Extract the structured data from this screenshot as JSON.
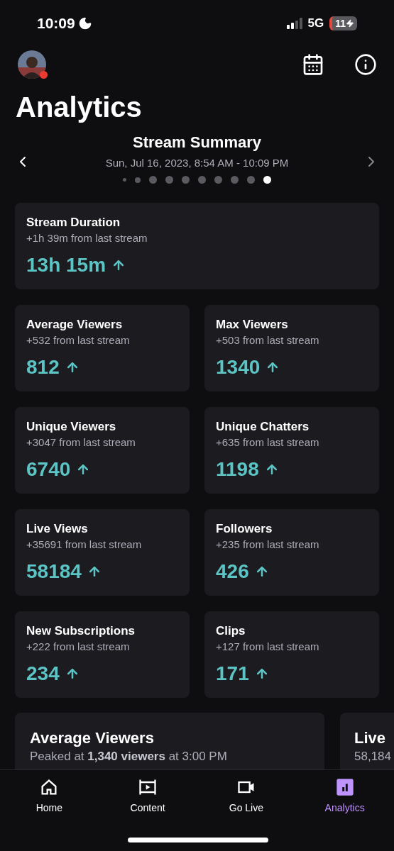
{
  "status_bar": {
    "time": "10:09",
    "network": "5G",
    "battery": "11"
  },
  "title": "Analytics",
  "summary": {
    "title": "Stream Summary",
    "date": "Sun, Jul 16, 2023, 8:54 AM - 10:09 PM",
    "pages": [
      {
        "selected": false
      },
      {
        "selected": false
      },
      {
        "selected": false
      },
      {
        "selected": false
      },
      {
        "selected": false
      },
      {
        "selected": false
      },
      {
        "selected": false
      },
      {
        "selected": false
      },
      {
        "selected": false
      },
      {
        "selected": true
      }
    ]
  },
  "stats": [
    {
      "label": "Stream Duration",
      "change": "+1h 39m from last stream",
      "value": "13h 15m",
      "wide": true
    },
    {
      "label": "Average Viewers",
      "change": "+532 from last stream",
      "value": "812",
      "wide": false
    },
    {
      "label": "Max Viewers",
      "change": "+503 from last stream",
      "value": "1340",
      "wide": false
    },
    {
      "label": "Unique Viewers",
      "change": "+3047 from last stream",
      "value": "6740",
      "wide": false
    },
    {
      "label": "Unique Chatters",
      "change": "+635 from last stream",
      "value": "1198",
      "wide": false
    },
    {
      "label": "Live Views",
      "change": "+35691 from last stream",
      "value": "58184",
      "wide": false
    },
    {
      "label": "Followers",
      "change": "+235 from last stream",
      "value": "426",
      "wide": false
    },
    {
      "label": "New Subscriptions",
      "change": "+222 from last stream",
      "value": "234",
      "wide": false
    },
    {
      "label": "Clips",
      "change": "+127 from last stream",
      "value": "171",
      "wide": false
    }
  ],
  "charts": [
    {
      "title": "Average Viewers",
      "subtitle": "Peaked at **1,340 viewers** at 3:00 PM"
    },
    {
      "title": "Live",
      "subtitle": "58,184"
    }
  ],
  "nav": [
    {
      "kind": "home",
      "label": "Home",
      "selected": false
    },
    {
      "kind": "content",
      "label": "Content",
      "selected": false
    },
    {
      "kind": "live",
      "label": "Go Live",
      "selected": false
    },
    {
      "kind": "analytics",
      "label": "Analytics",
      "selected": true
    }
  ]
}
